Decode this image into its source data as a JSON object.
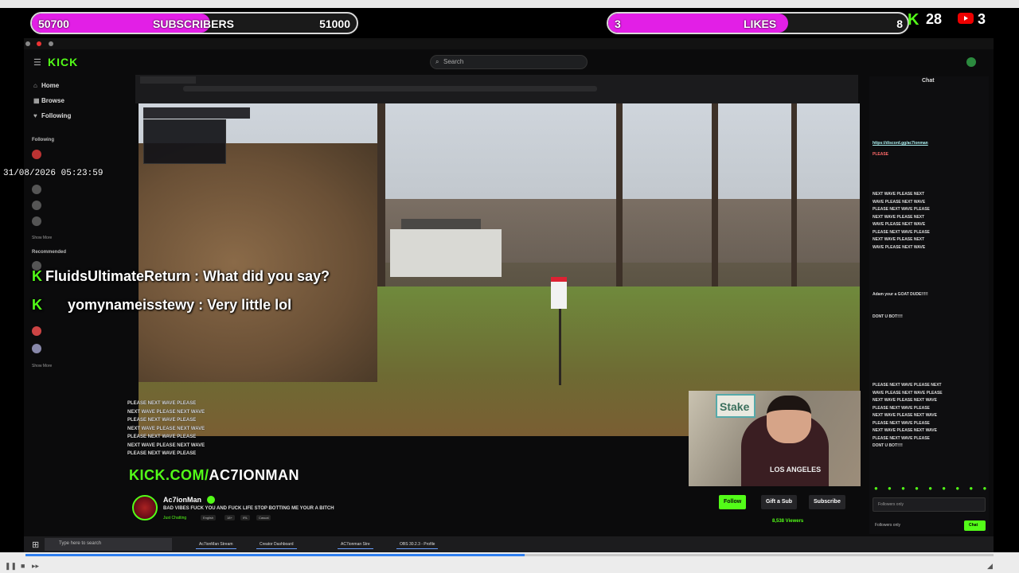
{
  "overlay": {
    "subscribers": {
      "current": "50700",
      "label": "SUBSCRIBERS",
      "goal": "51000",
      "progress": 0.55
    },
    "likes": {
      "current": "3",
      "label": "LIKES",
      "goal": "8",
      "progress": 0.6
    },
    "kick_count": "28",
    "youtube_count": "3",
    "datetime": "31/08/2026 05:23:59"
  },
  "kick": {
    "logo": "KICK",
    "search_placeholder": "Search",
    "nav": [
      "Home",
      "Browse",
      "Following"
    ],
    "following_heading": "Following",
    "recommended_heading": "Recommended",
    "show_more": "Show More"
  },
  "chat_overlay": [
    {
      "user": "FluidsUltimateReturn",
      "sep": " : ",
      "text": "What did you say?"
    },
    {
      "user": "yomynameisstewy",
      "sep": " : ",
      "text": "Very little lol"
    }
  ],
  "stacked_chat": [
    "PLEASE NEXT WAVE PLEASE",
    "NEXT WAVE PLEASE NEXT WAVE",
    "PLEASE NEXT WAVE PLEASE",
    "NEXT WAVE PLEASE NEXT WAVE",
    "PLEASE NEXT WAVE PLEASE",
    "NEXT WAVE PLEASE NEXT WAVE",
    "PLEASE NEXT WAVE PLEASE"
  ],
  "kick_url": {
    "prefix": "KICK.COM/",
    "channel": "AC7IONMAN"
  },
  "channel": {
    "name": "Ac7ionMan",
    "title": "BAD VIBES FUCK YOU AND FUCK LIFE STOP BOTTING ME YOUR A BITCH",
    "category": "Just Chatting",
    "tags": [
      "English",
      "18+",
      "IRL",
      "Casual"
    ],
    "follow": "Follow",
    "gift": "Gift a Sub",
    "subscribe": "Subscribe",
    "viewers": "8,538 Viewers"
  },
  "webcam": {
    "sign": "Stake",
    "shirt": "LOS ANGELES"
  },
  "chat_panel": {
    "title": "Chat",
    "link": "https://discord.gg/ac7ionman",
    "lines": [
      "PLEASE",
      "NEXT WAVE PLEASE NEXT",
      "WAVE PLEASE NEXT WAVE",
      "PLEASE NEXT WAVE PLEASE",
      "NEXT WAVE PLEASE NEXT",
      "WAVE PLEASE NEXT WAVE",
      "PLEASE NEXT WAVE PLEASE",
      "NEXT WAVE PLEASE NEXT",
      "WAVE PLEASE NEXT WAVE"
    ],
    "mid_lines": [
      "Adam your a GOAT DUDE!!!!!",
      "DONT U BOT!!!!",
      "PLEASE NEXT WAVE PLEASE NEXT",
      "WAVE PLEASE NEXT WAVE PLEASE",
      "NEXT WAVE PLEASE NEXT WAVE",
      "PLEASE NEXT WAVE PLEASE",
      "NEXT WAVE PLEASE NEXT WAVE",
      "PLEASE NEXT WAVE PLEASE",
      "NEXT WAVE PLEASE NEXT WAVE",
      "PLEASE NEXT WAVE PLEASE",
      "DONT U BOT!!!!"
    ],
    "input_placeholder": "Followers only",
    "footer": "Followers only",
    "send": "Chat"
  },
  "taskbar": {
    "search": "Type here to search",
    "items": [
      "Ac7ionMan Stream",
      "Creator Dashboard",
      "AC7ionman Stre",
      "OBS 30.2.3 - Profile"
    ]
  },
  "colors": {
    "kick_green": "#53fc18",
    "bar_magenta": "#e21fe6"
  }
}
